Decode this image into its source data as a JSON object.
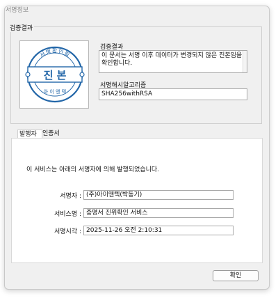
{
  "window": {
    "title": "서명정보"
  },
  "verification": {
    "group_title": "검증결과",
    "result_label": "검증결과",
    "result_text": "이 문서는 서명 이후 데이터가 변경되지 않은 진본임을 확인합니다.",
    "hash_label": "서명해시알고리즘",
    "hash_value": "SHA256withRSA"
  },
  "seal": {
    "top_text": "서명확인필",
    "center_text": "진 본",
    "bottom_text": "아 이 앤 텍",
    "color": "#2266a8"
  },
  "tabs": [
    {
      "label": "발행자"
    },
    {
      "label": "인증서"
    }
  ],
  "issuer": {
    "message": "이 서비스는 아래의 서명자에 의해 발행되었습니다.",
    "signer_label": "서명자 :",
    "signer_value": "(주)아이앤텍(박동기)",
    "service_label": "서비스명 :",
    "service_value": "증명서 진위확인 서비스",
    "time_label": "서명시각 :",
    "time_value": "2025-11-26 오전 2:10:31"
  },
  "buttons": {
    "ok": "확인"
  }
}
